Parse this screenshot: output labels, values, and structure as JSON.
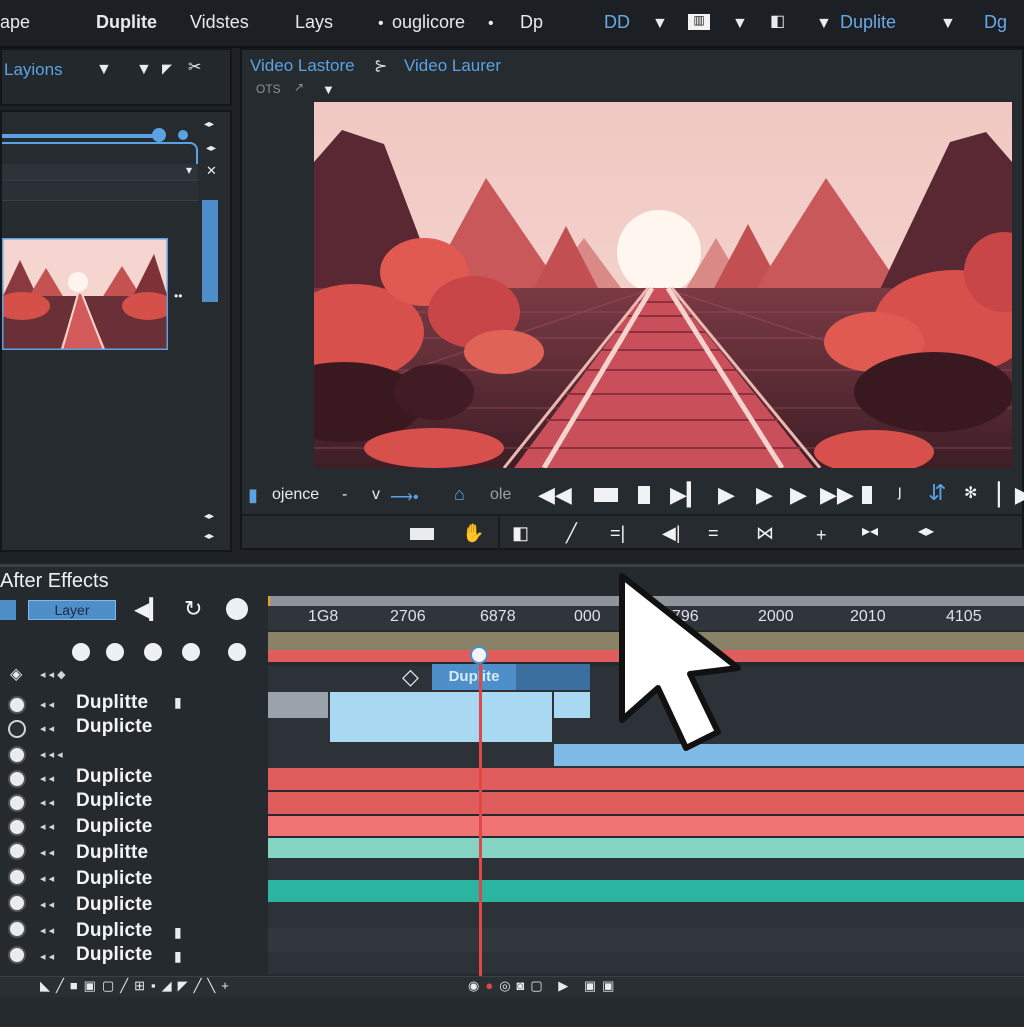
{
  "menu": [
    "ape",
    "Duplite",
    "Vidstes",
    "Lays",
    "ouglicore",
    "Dp",
    "DD",
    "Duplite",
    "Dg"
  ],
  "left_panel": {
    "title": "Layions"
  },
  "viewer": {
    "tab1": "Video Lastore",
    "tab2": "Video Laurer",
    "subtitle": "OTS",
    "status_label": "ojence",
    "status_v": "v",
    "status_ole": "ole"
  },
  "timeline": {
    "app_title": "After Effects",
    "layer_button": "Layer",
    "ruler": [
      "1G8",
      "2706",
      "6878",
      "000",
      "796",
      "2000",
      "2010",
      "4105"
    ],
    "clip_label": "Duplite",
    "layers": [
      "Duplitte",
      "Duplicte",
      "Duplicte",
      "Duplicte",
      "Duplicte",
      "Duplitte",
      "Duplicte",
      "Duplicte",
      "Duplicte",
      "Duplicte"
    ]
  },
  "colors": {
    "accent_blue": "#5aa2e2",
    "track_red": "#e05d5d",
    "track_teal": "#2bb5a0",
    "track_light_blue": "#a9d8f2",
    "playhead": "#e04848"
  },
  "icons": [
    "play-icon",
    "pause-icon",
    "stop-icon",
    "rewind-icon",
    "fast-forward-icon",
    "eye-icon",
    "cursor-icon",
    "scissors-icon"
  ]
}
